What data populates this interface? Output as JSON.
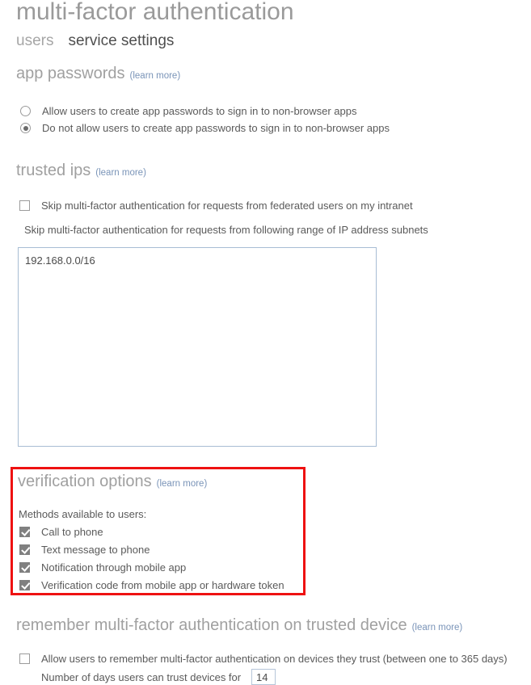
{
  "page": {
    "title": "multi-factor authentication"
  },
  "tabs": [
    {
      "label": "users",
      "active": false
    },
    {
      "label": "service settings",
      "active": true
    }
  ],
  "learn_more_label": "(learn more)",
  "sections": {
    "app_passwords": {
      "heading": "app passwords",
      "learn_more": "(learn more)",
      "options": [
        {
          "label": "Allow users to create app passwords to sign in to non-browser apps",
          "selected": false
        },
        {
          "label": "Do not allow users to create app passwords to sign in to non-browser apps",
          "selected": true
        }
      ]
    },
    "trusted_ips": {
      "heading": "trusted ips",
      "learn_more": "(learn more)",
      "checkbox": {
        "label": "Skip multi-factor authentication for requests from federated users on my intranet",
        "checked": false
      },
      "subnet_label": "Skip multi-factor authentication for requests from following range of IP address subnets",
      "subnet_value": "192.168.0.0/16",
      "subnet_placeholder": ""
    },
    "verification_options": {
      "heading": "verification options",
      "learn_more": "(learn more)",
      "methods_label": "Methods available to users:",
      "methods": [
        {
          "label": "Call to phone",
          "checked": true
        },
        {
          "label": "Text message to phone",
          "checked": true
        },
        {
          "label": "Notification through mobile app",
          "checked": true
        },
        {
          "label": "Verification code from mobile app or hardware token",
          "checked": true
        }
      ],
      "highlight_color": "#ee1111"
    },
    "remember_mfa": {
      "heading": "remember multi-factor authentication on trusted device",
      "learn_more": "(learn more)",
      "checkbox": {
        "label": "Allow users to remember multi-factor authentication on devices they trust (between one to 365 days)",
        "checked": false
      },
      "days_label": "Number of days users can trust devices for",
      "days_value": "14"
    }
  },
  "colors": {
    "heading": "#a0a0a0",
    "body_text": "#5a5a5a",
    "link": "#7a94b8",
    "highlight": "#ee1111",
    "field_border": "#a8bdd4"
  }
}
